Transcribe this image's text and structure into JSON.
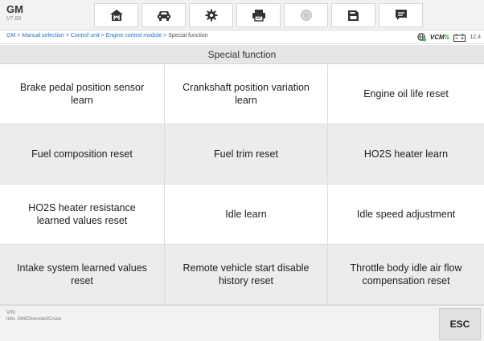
{
  "app": {
    "name": "GM",
    "version": "V7.60"
  },
  "toolbar": {
    "icons": [
      "home-icon",
      "vehicle-icon",
      "settings-icon",
      "print-icon",
      "help-icon",
      "save-icon",
      "message-icon"
    ]
  },
  "breadcrumb": {
    "items": [
      "GM",
      "Manual selection",
      "Control unit",
      "Engine control module",
      "Special function"
    ],
    "separator": " > "
  },
  "status": {
    "vcm_label": "VCM",
    "battery_voltage": "12.4"
  },
  "page": {
    "title": "Special function"
  },
  "functions": [
    "Brake pedal position sensor learn",
    "Crankshaft position variation learn",
    "Engine oil life reset",
    "Fuel composition reset",
    "Fuel trim reset",
    "HO2S heater learn",
    "HO2S heater resistance learned values reset",
    "Idle learn",
    "Idle speed adjustment",
    "Intake system learned values reset",
    "Remote vehicle start disable history reset",
    "Throttle body idle air flow compensation reset"
  ],
  "footer": {
    "vin_label": "VIN:",
    "info_label": "Info: GM/Chevrolet/Cruze",
    "esc_label": "ESC"
  },
  "colors": {
    "link": "#2a72c8",
    "ok": "#3ab54a"
  }
}
